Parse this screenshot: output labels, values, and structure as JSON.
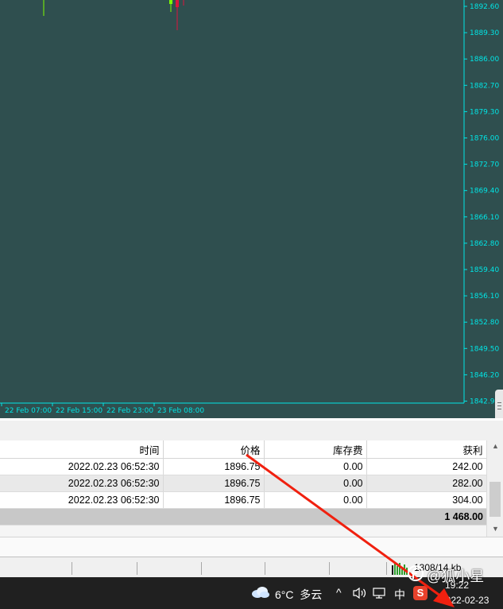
{
  "chart": {
    "price_labels": [
      "1892.60",
      "1889.30",
      "1886.00",
      "1882.70",
      "1879.30",
      "1876.00",
      "1872.70",
      "1869.40",
      "1866.10",
      "1862.80",
      "1859.40",
      "1856.10",
      "1852.80",
      "1849.50",
      "1846.20",
      "1842.90"
    ],
    "time_labels": [
      "22 Feb 07:00",
      "22 Feb 15:00",
      "22 Feb 23:00",
      "23 Feb 08:00"
    ],
    "background_color": "#2f4f4f",
    "axis_color": "#00e5e5",
    "bull_color": "#7cfc00",
    "bear_color": "#dc143c"
  },
  "terminal": {
    "columns": {
      "time": "时间",
      "price": "价格",
      "swap": "库存费",
      "profit": "获利"
    },
    "rows": [
      {
        "time": "2022.02.23 06:52:30",
        "price": "1896.75",
        "swap": "0.00",
        "profit": "242.00"
      },
      {
        "time": "2022.02.23 06:52:30",
        "price": "1896.75",
        "swap": "0.00",
        "profit": "282.00"
      },
      {
        "time": "2022.02.23 06:52:30",
        "price": "1896.75",
        "swap": "0.00",
        "profit": "304.00"
      }
    ],
    "total_profit": "1 468.00"
  },
  "statusbar": {
    "traffic": "1308/14 kb"
  },
  "taskbar": {
    "weather": "6°C  多云",
    "ime": "中",
    "sogou": "S",
    "time": "19:22",
    "date": "2022-02-23"
  },
  "watermark": {
    "text": "@狐小星"
  }
}
